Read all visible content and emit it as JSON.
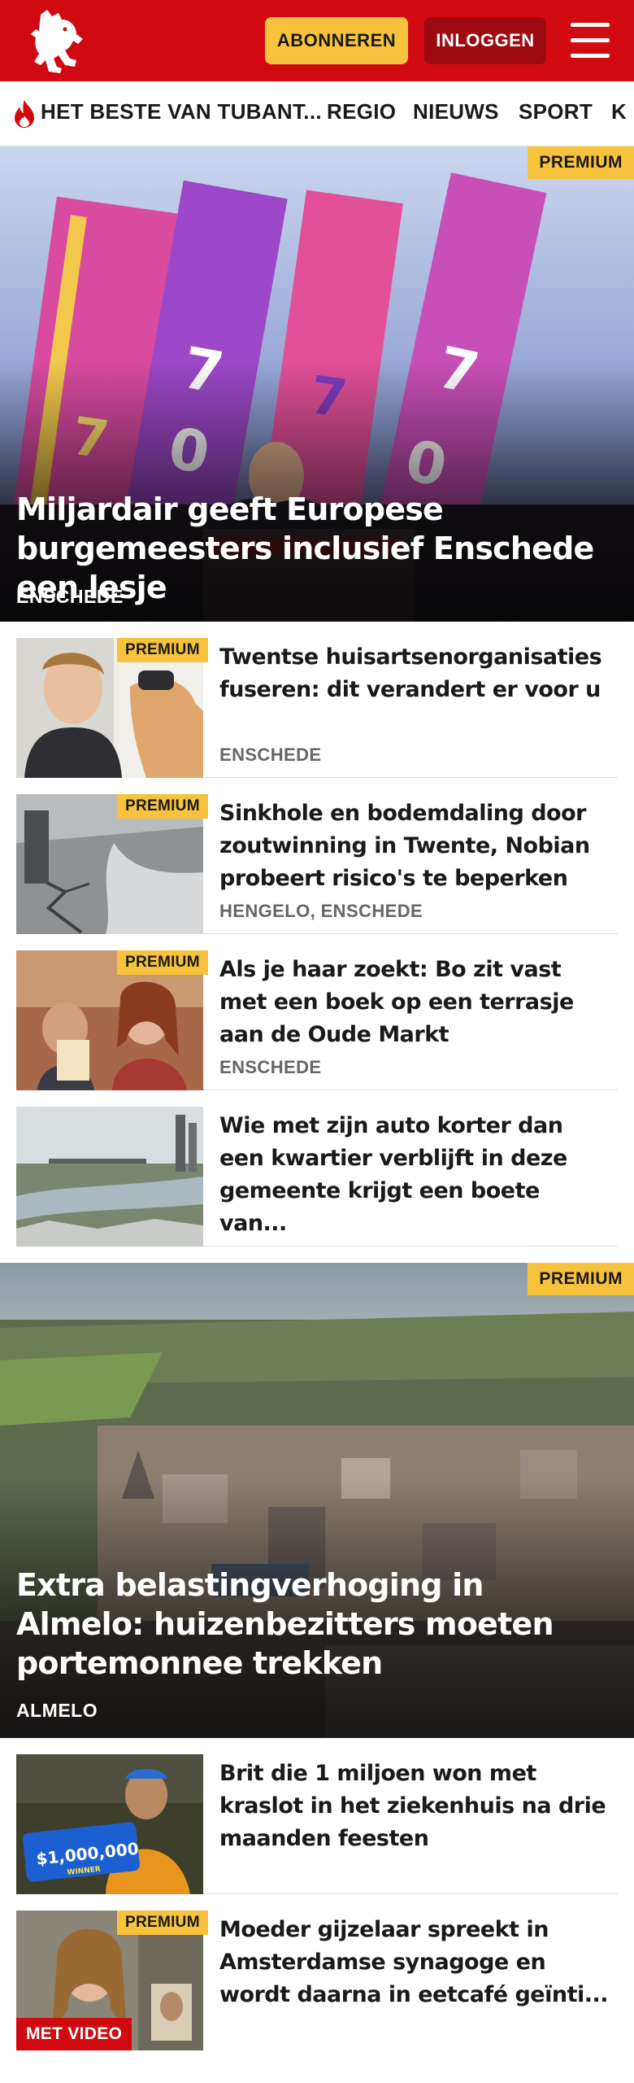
{
  "header": {
    "logo_icon": "tubantia-horse-logo-icon",
    "subscribe_label": "ABONNEREN",
    "login_label": "INLOGGEN",
    "menu_icon": "hamburger-menu-icon",
    "colors": {
      "brand_red": "#d10a11",
      "premium_yellow": "#f7c33c",
      "login_dark_red": "#9d0a10"
    }
  },
  "nav": {
    "items": [
      {
        "label": "HET BESTE VAN TUBANT...",
        "icon": "flame-icon"
      },
      {
        "label": "REGIO"
      },
      {
        "label": "NIEUWS"
      },
      {
        "label": "SPORT"
      },
      {
        "label": "K"
      }
    ]
  },
  "hero1": {
    "badge": "PREMIUM",
    "title": "Miljardair geeft Europese burgemeesters inclusief Enschede een lesje",
    "location": "ENSCHEDE"
  },
  "articles": [
    {
      "badge": "PREMIUM",
      "headline": "Twentse huisartsenorganisaties fuseren: dit verandert er voor u",
      "location": "ENSCHEDE"
    },
    {
      "badge": "PREMIUM",
      "headline": "Sinkhole en bodemdaling door zoutwinning in Twente, Nobian probeert risico's te beperken",
      "location": "HENGELO, ENSCHEDE"
    },
    {
      "badge": "PREMIUM",
      "headline": "Als je haar zoekt: Bo zit vast met een boek op een terrasje aan de Oude Markt",
      "location": "ENSCHEDE"
    },
    {
      "headline": "Wie met zijn auto korter dan een kwartier verblijft in deze gemeente krijgt een boete van..."
    }
  ],
  "hero2": {
    "badge": "PREMIUM",
    "title": "Extra belastingverhoging in Almelo: huizenbezitters moeten portemonnee trekken",
    "location": "ALMELO"
  },
  "articles2": [
    {
      "headline": "Brit die 1 miljoen won met kraslot in het ziekenhuis na drie maanden feesten",
      "image_text": "$1,000,000",
      "image_text_small": "WINNER"
    },
    {
      "badge": "PREMIUM",
      "headline": "Moeder gijzelaar spreekt in Amsterdamse synagoge en wordt daarna in eetcafé geïnti...",
      "video_badge": "MET VIDEO"
    }
  ]
}
